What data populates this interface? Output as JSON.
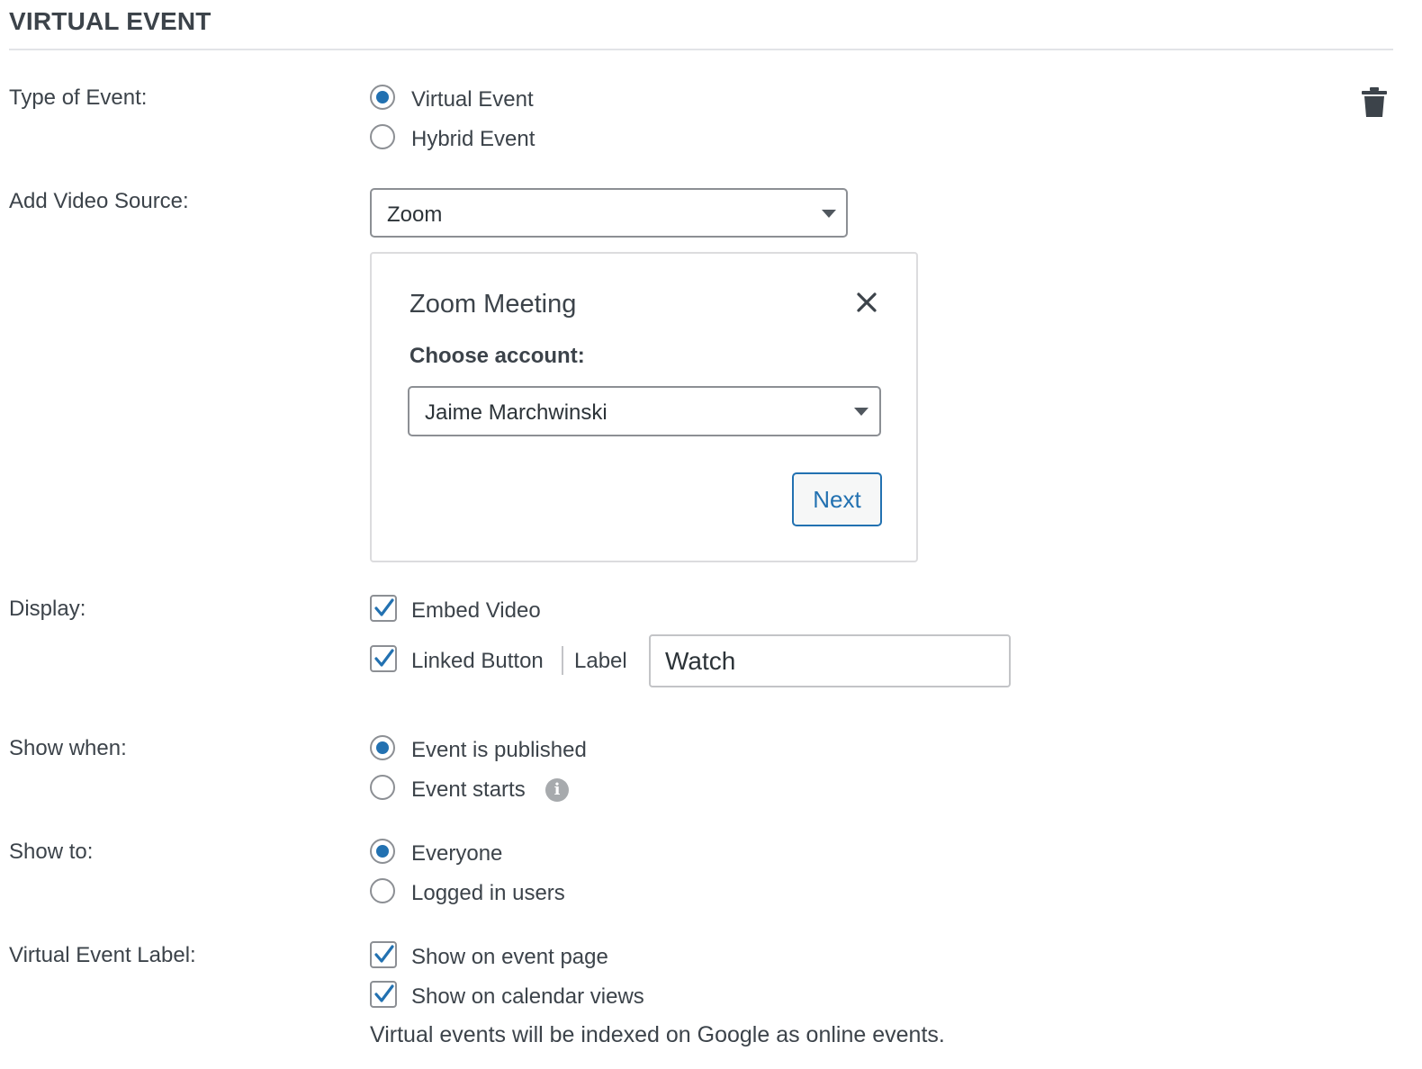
{
  "section": {
    "title": "VIRTUAL EVENT"
  },
  "type_of_event": {
    "label": "Type of Event:",
    "options": [
      {
        "label": "Virtual Event",
        "checked": true
      },
      {
        "label": "Hybrid Event",
        "checked": false
      }
    ]
  },
  "video_source": {
    "label": "Add Video Source:",
    "selected": "Zoom"
  },
  "zoom_modal": {
    "title": "Zoom Meeting",
    "choose_account_label": "Choose account:",
    "account_selected": "Jaime Marchwinski",
    "next_label": "Next"
  },
  "display": {
    "label": "Display:",
    "embed_video": {
      "label": "Embed Video",
      "checked": true
    },
    "linked_button": {
      "label": "Linked Button",
      "checked": true
    },
    "button_label_caption": "Label",
    "button_label_value": "Watch"
  },
  "show_when": {
    "label": "Show when:",
    "options": [
      {
        "label": "Event is published",
        "checked": true
      },
      {
        "label": "Event starts",
        "checked": false
      }
    ],
    "info_icon": "i"
  },
  "show_to": {
    "label": "Show to:",
    "options": [
      {
        "label": "Everyone",
        "checked": true
      },
      {
        "label": "Logged in users",
        "checked": false
      }
    ]
  },
  "virtual_event_label": {
    "label": "Virtual Event Label:",
    "options": [
      {
        "label": "Show on event page",
        "checked": true
      },
      {
        "label": "Show on calendar views",
        "checked": true
      }
    ],
    "note": "Virtual events will be indexed on Google as online events."
  },
  "colors": {
    "accent": "#2271b1",
    "text": "#3c434a",
    "border": "#8c8f94"
  }
}
